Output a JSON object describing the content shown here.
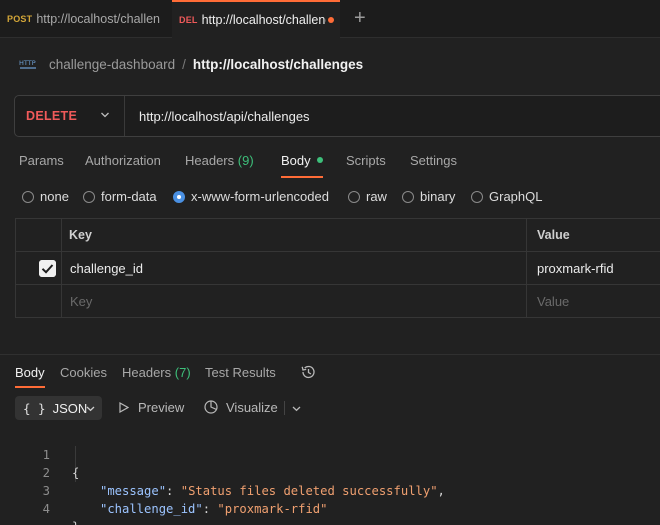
{
  "tabs": [
    {
      "method": "POST",
      "url": "http://localhost/challen"
    },
    {
      "method": "DEL",
      "url": "http://localhost/challenges"
    }
  ],
  "breadcrumb": {
    "collection": "challenge-dashboard",
    "separator": "/",
    "request": "http://localhost/challenges"
  },
  "request": {
    "method": "DELETE",
    "url": "http://localhost/api/challenges"
  },
  "request_tabs": {
    "params": "Params",
    "authorization": "Authorization",
    "headers": "Headers",
    "headers_count": "(9)",
    "body": "Body",
    "scripts": "Scripts",
    "settings": "Settings"
  },
  "body_types": {
    "none": "none",
    "form_data": "form-data",
    "urlencoded": "x-www-form-urlencoded",
    "raw": "raw",
    "binary": "binary",
    "graphql": "GraphQL",
    "selected": "x-www-form-urlencoded"
  },
  "kv_table": {
    "header_key": "Key",
    "header_value": "Value",
    "rows": [
      {
        "key": "challenge_id",
        "value": "proxmark-rfid",
        "checked": true
      }
    ],
    "placeholder_key": "Key",
    "placeholder_value": "Value"
  },
  "response_tabs": {
    "body": "Body",
    "cookies": "Cookies",
    "headers": "Headers",
    "headers_count": "(7)",
    "test_results": "Test Results"
  },
  "response_toolbar": {
    "format_icon": "{ }",
    "format": "JSON",
    "preview": "Preview",
    "visualize": "Visualize"
  },
  "response_body": {
    "lines": [
      "1",
      "2",
      "3",
      "4"
    ],
    "open_brace": "{",
    "close_brace": "}",
    "message_key": "\"message\"",
    "message_value": "\"Status files deleted successfully\"",
    "challenge_key": "\"challenge_id\"",
    "challenge_value": "\"proxmark-rfid\""
  },
  "colors": {
    "accent": "#ff6c37",
    "delete_method": "#f05a5a",
    "post_method": "#d3a638",
    "count_green": "#3dbf7a",
    "radio_selected": "#4a90e2"
  }
}
